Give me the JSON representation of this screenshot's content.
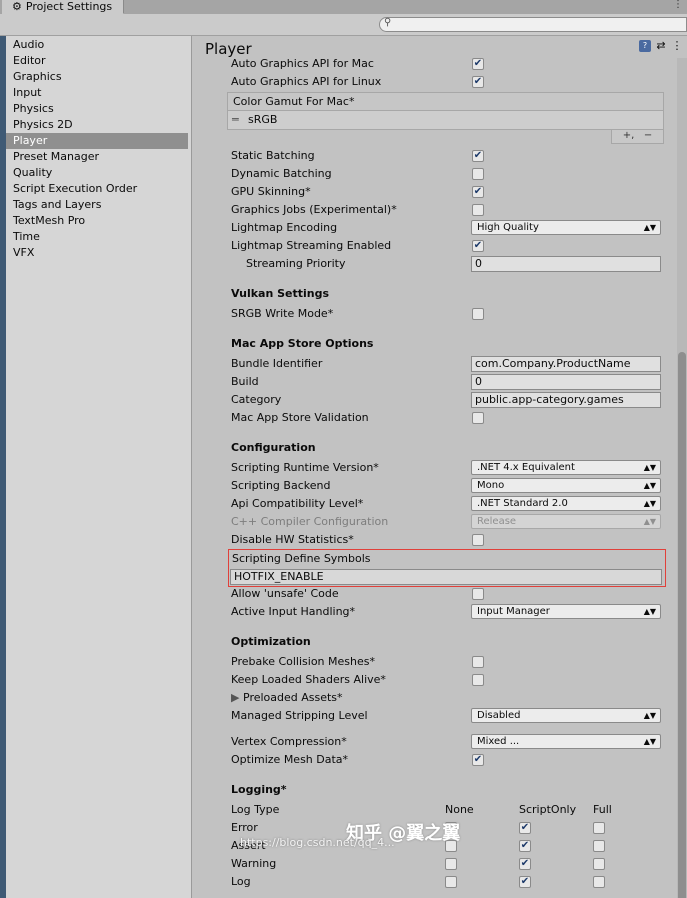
{
  "window": {
    "tab_title": "Project Settings",
    "menu": "⋮"
  },
  "search": {
    "placeholder": ""
  },
  "sidebar": {
    "items": [
      {
        "label": "Audio"
      },
      {
        "label": "Editor"
      },
      {
        "label": "Graphics"
      },
      {
        "label": "Input"
      },
      {
        "label": "Physics"
      },
      {
        "label": "Physics 2D"
      },
      {
        "label": "Player",
        "selected": true
      },
      {
        "label": "Preset Manager"
      },
      {
        "label": "Quality"
      },
      {
        "label": "Script Execution Order"
      },
      {
        "label": "Tags and Layers"
      },
      {
        "label": "TextMesh Pro"
      },
      {
        "label": "Time"
      },
      {
        "label": "VFX"
      }
    ]
  },
  "main": {
    "title": "Player",
    "rows_top": {
      "auto_mac": "Auto Graphics API  for Mac",
      "auto_linux": "Auto Graphics API  for Linux"
    },
    "gamut": {
      "header": "Color Gamut For Mac*",
      "item": "sRGB",
      "add": "+,",
      "remove": "−"
    },
    "settings": {
      "static_batching": "Static Batching",
      "dynamic_batching": "Dynamic Batching",
      "gpu_skinning": "GPU Skinning*",
      "graphics_jobs": "Graphics Jobs (Experimental)*",
      "lightmap_encoding": "Lightmap Encoding",
      "lightmap_encoding_value": "High Quality",
      "lightmap_streaming": "Lightmap Streaming Enabled",
      "streaming_priority": "Streaming Priority",
      "streaming_priority_value": "0"
    },
    "vulkan": {
      "header": "Vulkan Settings",
      "srgb_write": "SRGB Write Mode*"
    },
    "mac_store": {
      "header": "Mac App Store Options",
      "bundle_id": "Bundle Identifier",
      "bundle_id_value": "com.Company.ProductName",
      "build": "Build",
      "build_value": "0",
      "category": "Category",
      "category_value": "public.app-category.games",
      "validation": "Mac App Store Validation"
    },
    "config": {
      "header": "Configuration",
      "runtime": "Scripting Runtime Version*",
      "runtime_value": ".NET 4.x Equivalent",
      "backend": "Scripting Backend",
      "backend_value": "Mono",
      "api_level": "Api Compatibility Level*",
      "api_level_value": ".NET Standard 2.0",
      "cpp_config": "C++ Compiler Configuration",
      "cpp_config_value": "Release",
      "disable_hw": "Disable HW Statistics*",
      "define_symbols": "Scripting Define Symbols",
      "define_symbols_value": "HOTFIX_ENABLE",
      "allow_unsafe": "Allow 'unsafe' Code",
      "active_input": "Active Input Handling*",
      "active_input_value": "Input Manager"
    },
    "optimization": {
      "header": "Optimization",
      "prebake": "Prebake Collision Meshes*",
      "keep_shaders": "Keep Loaded Shaders Alive*",
      "preloaded": "Preloaded Assets*",
      "stripping": "Managed Stripping Level",
      "stripping_value": "Disabled",
      "vertex_compression": "Vertex Compression*",
      "vertex_compression_value": "Mixed ...",
      "optimize_mesh": "Optimize Mesh Data*"
    },
    "logging": {
      "header": "Logging*",
      "log_type": "Log Type",
      "col_none": "None",
      "col_script": "ScriptOnly",
      "col_full": "Full",
      "error": "Error",
      "assert": "Assert",
      "warning": "Warning",
      "log": "Log"
    }
  },
  "watermark": {
    "big": "知乎 @翼之翼",
    "small": "https://blog.csdn.net/qq_4..."
  }
}
